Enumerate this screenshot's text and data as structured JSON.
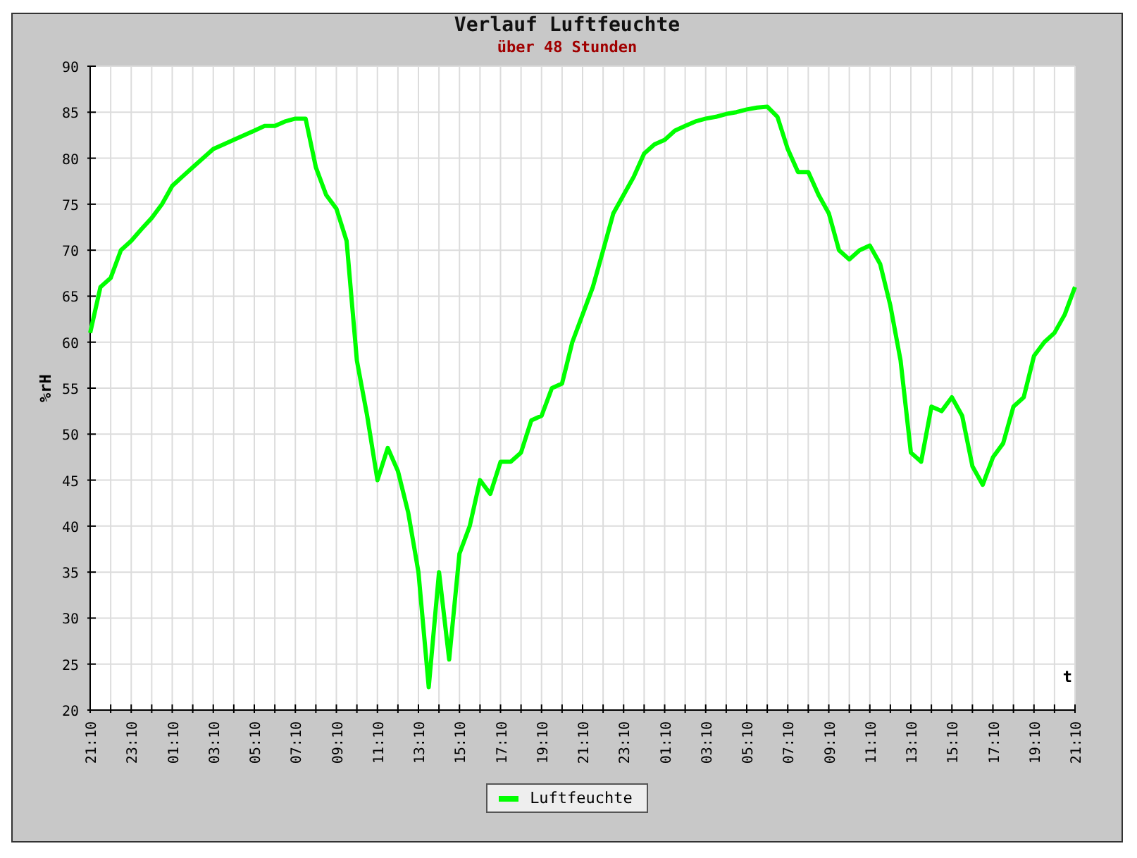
{
  "chart": {
    "subtitle": "über 48 Stunden",
    "chart_data": {
      "type": "line",
      "grid": true,
      "title": "Verlauf Luftfeuchte",
      "xlabel": "t",
      "ylabel": "%rH",
      "ylim": [
        20,
        90
      ],
      "yticks": [
        20,
        25,
        30,
        35,
        40,
        45,
        50,
        55,
        60,
        65,
        70,
        75,
        80,
        85,
        90
      ],
      "categories": [
        "21:10",
        null,
        null,
        null,
        "23:10",
        null,
        null,
        null,
        "01:10",
        null,
        null,
        null,
        "03:10",
        null,
        null,
        null,
        "05:10",
        null,
        null,
        null,
        "07:10",
        null,
        null,
        null,
        "09:10",
        null,
        null,
        null,
        "11:10",
        null,
        null,
        null,
        "13:10",
        null,
        null,
        null,
        "15:10",
        null,
        null,
        null,
        "17:10",
        null,
        null,
        null,
        "19:10",
        null,
        null,
        null,
        "21:10",
        null,
        null,
        null,
        "23:10",
        null,
        null,
        null,
        "01:10",
        null,
        null,
        null,
        "03:10",
        null,
        null,
        null,
        "05:10",
        null,
        null,
        null,
        "07:10",
        null,
        null,
        null,
        "09:10",
        null,
        null,
        null,
        "11:10",
        null,
        null,
        null,
        "13:10",
        null,
        null,
        null,
        "15:10",
        null,
        null,
        null,
        "17:10",
        null,
        null,
        null,
        "19:10",
        null,
        null,
        null,
        "21:10"
      ],
      "series": [
        {
          "name": "Luftfeuchte",
          "color": "#00ff00",
          "values": [
            61,
            66,
            67,
            70,
            71,
            72.3,
            73.5,
            75,
            77,
            78,
            79,
            80,
            81,
            81.5,
            82,
            82.5,
            83,
            83.5,
            83.5,
            84,
            84.3,
            84.3,
            79,
            76,
            74.5,
            71,
            58,
            52,
            45,
            48.5,
            46,
            41.5,
            35,
            22.5,
            35,
            25.5,
            37,
            40,
            45,
            43.5,
            47,
            47,
            48,
            51.5,
            52,
            55,
            55.5,
            60,
            63,
            66,
            70,
            74,
            76,
            78,
            80.5,
            81.5,
            82,
            83,
            83.5,
            84,
            84.3,
            84.5,
            84.8,
            85,
            85.3,
            85.5,
            85.6,
            84.5,
            81,
            78.5,
            78.5,
            76,
            74,
            70,
            69,
            70,
            70.5,
            68.5,
            64,
            58,
            48,
            47,
            53,
            52.5,
            54,
            52,
            46.5,
            44.5,
            47.5,
            49,
            53,
            54,
            58.5,
            60,
            61,
            63,
            66
          ]
        }
      ]
    }
  }
}
